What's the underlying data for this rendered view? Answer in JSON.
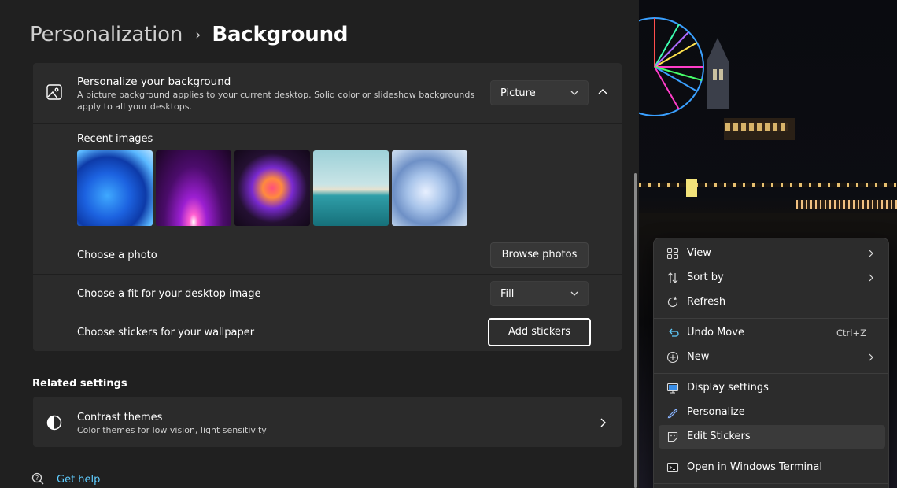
{
  "breadcrumb": {
    "parent": "Personalization",
    "separator": "›",
    "current": "Background"
  },
  "background_card": {
    "title": "Personalize your background",
    "description": "A picture background applies to your current desktop. Solid color or slideshow backgrounds apply to all your desktops.",
    "type_dropdown": "Picture",
    "recent_images_label": "Recent images",
    "recent_images_count": 5,
    "choose_photo": {
      "label": "Choose a photo",
      "button": "Browse photos"
    },
    "fit": {
      "label": "Choose a fit for your desktop image",
      "value": "Fill"
    },
    "stickers": {
      "label": "Choose stickers for your wallpaper",
      "button": "Add stickers"
    }
  },
  "related": {
    "title": "Related settings",
    "contrast": {
      "title": "Contrast themes",
      "description": "Color themes for low vision, light sensitivity"
    }
  },
  "get_help": "Get help",
  "context_menu": {
    "items": [
      {
        "label": "View",
        "icon": "grid-icon",
        "submenu": true
      },
      {
        "label": "Sort by",
        "icon": "sort-icon",
        "submenu": true
      },
      {
        "label": "Refresh",
        "icon": "refresh-icon"
      },
      {
        "label": "Undo Move",
        "icon": "undo-icon",
        "shortcut": "Ctrl+Z"
      },
      {
        "label": "New",
        "icon": "plus-circle-icon",
        "submenu": true
      },
      {
        "label": "Display settings",
        "icon": "display-icon"
      },
      {
        "label": "Personalize",
        "icon": "pen-icon"
      },
      {
        "label": "Edit Stickers",
        "icon": "sticker-icon",
        "highlighted": true
      },
      {
        "label": "Open in Windows Terminal",
        "icon": "terminal-icon"
      }
    ]
  },
  "colors": {
    "accent": "#60cdff",
    "panel": "#2b2b2b",
    "page": "#202020",
    "menu": "#2c2c2c"
  }
}
